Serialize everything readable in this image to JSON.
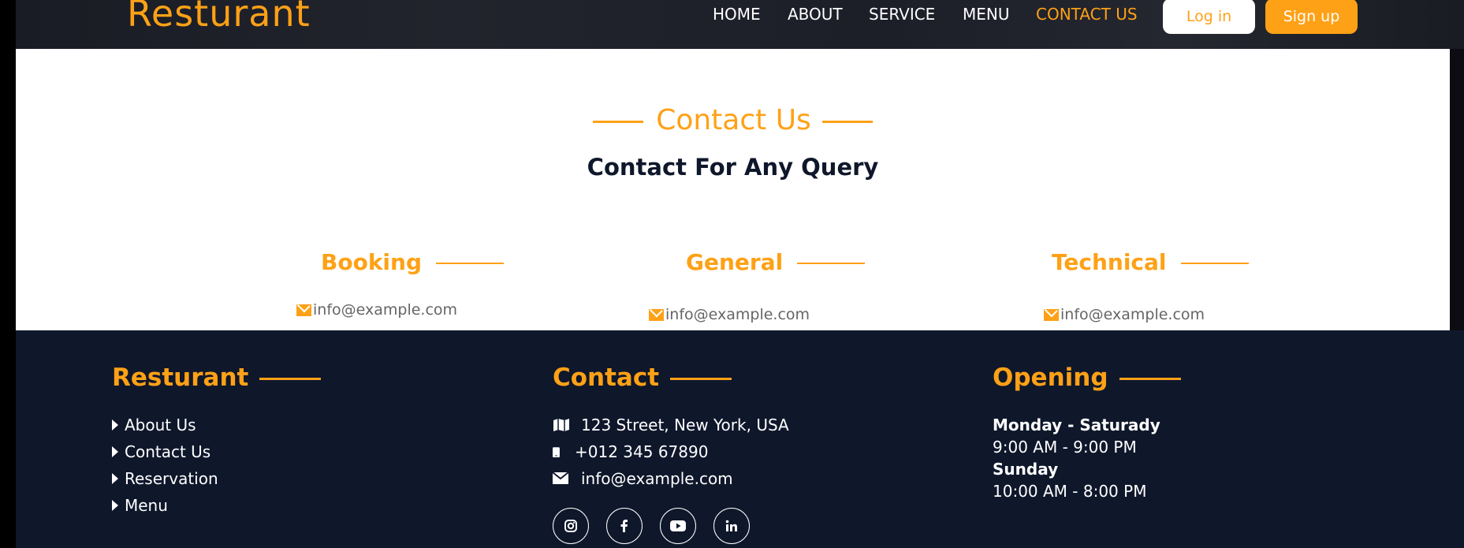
{
  "brand": "Resturant",
  "nav": {
    "links": [
      "HOME",
      "ABOUT",
      "SERVICE",
      "MENU",
      "CONTACT US"
    ],
    "active": "CONTACT US",
    "login_label": "Log in",
    "signup_label": "Sign up"
  },
  "contact": {
    "title": "Contact Us",
    "subtitle": "Contact For Any Query",
    "columns": [
      {
        "title": "Booking",
        "email": "info@example.com"
      },
      {
        "title": "General",
        "email": "info@example.com"
      },
      {
        "title": "Technical",
        "email": "info@example.com"
      }
    ]
  },
  "footer": {
    "brand_title": "Resturant",
    "links": [
      "About Us",
      "Contact Us",
      "Reservation",
      "Menu"
    ],
    "contact_title": "Contact",
    "address": "123 Street, New York, USA",
    "phone": "+012 345 67890",
    "email": "info@example.com",
    "opening_title": "Opening",
    "weekday_label": "Monday - Saturady",
    "weekday_hours": "9:00 AM - 9:00 PM",
    "sunday_label": "Sunday",
    "sunday_hours": "10:00 AM - 8:00 PM",
    "social": [
      "instagram-icon",
      "facebook-icon",
      "youtube-icon",
      "linkedin-icon"
    ]
  },
  "colors": {
    "accent": "#fea116",
    "navy": "#0f172b"
  }
}
